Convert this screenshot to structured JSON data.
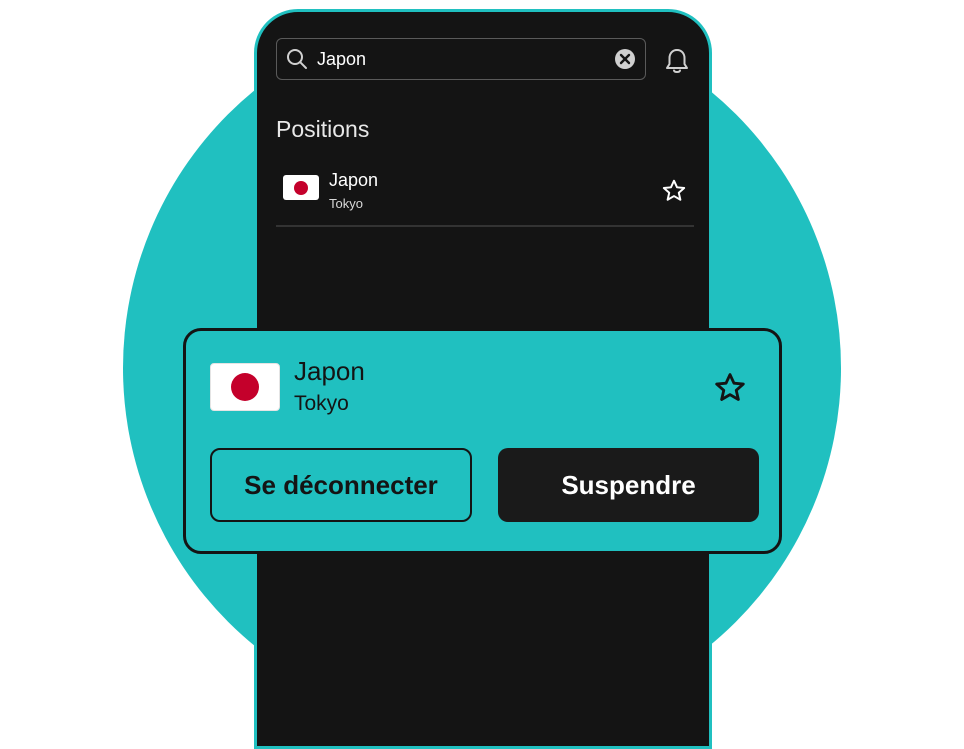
{
  "colors": {
    "accent": "#20c0c0",
    "background_dark": "#141414",
    "flag_red": "#c4002b"
  },
  "search": {
    "value": "Japon",
    "icon": "search-icon",
    "clear_icon": "clear-circle-icon"
  },
  "header": {
    "bell_icon": "bell-icon"
  },
  "positions": {
    "title": "Positions",
    "items": [
      {
        "country": "Japon",
        "city": "Tokyo",
        "flag_icon": "japan-flag-icon",
        "favorite_icon": "star-outline-icon"
      }
    ]
  },
  "card": {
    "country": "Japon",
    "city": "Tokyo",
    "flag_icon": "japan-flag-icon",
    "favorite_icon": "star-outline-icon",
    "disconnect_label": "Se déconnecter",
    "pause_label": "Suspendre"
  }
}
